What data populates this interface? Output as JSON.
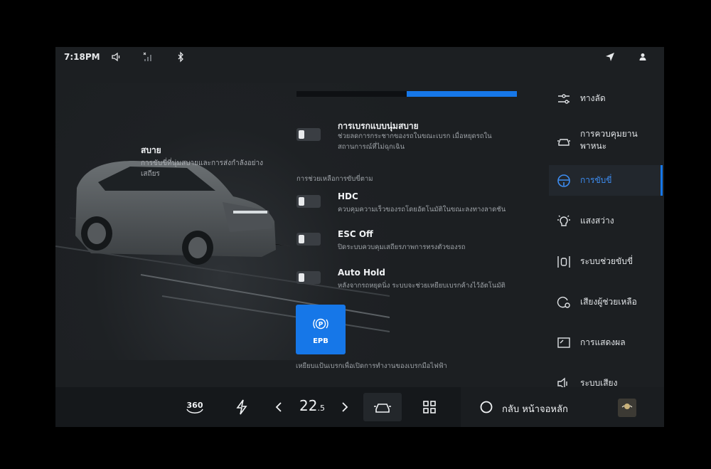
{
  "status": {
    "time": "7:18PM",
    "icons": [
      "volume-icon",
      "signal-icon",
      "bluetooth-icon",
      "navigation-icon",
      "user-icon"
    ]
  },
  "hero": {
    "title": "สบาย",
    "description": "การขับขี่ที่นุ่มสบายและการส่งกำลังอย่างเสถียร"
  },
  "progress": {
    "fraction": 0.5
  },
  "settings": [
    {
      "title": "การเบรกแบบนุ่มสบาย",
      "desc_line1": "ช่วยลดการกระชากของรถในขณะเบรก เมื่อหยุดรถใน",
      "desc_line2": "สถานการณ์ที่ไม่ฉุกเฉิน",
      "on": false
    },
    {
      "title": "HDC",
      "desc_line1": "ควบคุมความเร็วของรถโดยอัตโนมัติในขณะลงทางลาดชัน",
      "on": false
    },
    {
      "title": "ESC Off",
      "desc_line1": "ปิดระบบควบคุมเสถียรภาพการทรงตัวของรถ",
      "on": false
    },
    {
      "title": "Auto Hold",
      "desc_line1": "หลังจากรถหยุดนิ่ง ระบบจะช่วยเหยียบเบรกค้างไว้อัตโนมัติ",
      "on": false
    }
  ],
  "section_label": "การช่วยเหลือการขับขี่ตาม",
  "epb": {
    "label": "EPB",
    "note": "เหยียบแป้นเบรกเพื่อเปิดการทำงานของเบรกมือไฟฟ้า"
  },
  "sidebar": {
    "items": [
      {
        "label": "ทางลัด",
        "icon": "sliders-icon"
      },
      {
        "label": "การควบคุมยาน",
        "label2": "พาหนะ",
        "icon": "car-icon"
      },
      {
        "label": "การขับขี่",
        "icon": "steering-wheel-icon",
        "active": true
      },
      {
        "label": "แสงสว่าง",
        "icon": "light-bulb-icon"
      },
      {
        "label": "ระบบช่วยขับขี่",
        "icon": "driver-assist-icon"
      },
      {
        "label": "เสียงผู้ช่วยเหลือ",
        "icon": "voice-assistant-icon"
      },
      {
        "label": "การแสดงผล",
        "icon": "display-icon"
      },
      {
        "label": "ระบบเสียง",
        "icon": "speaker-icon"
      }
    ]
  },
  "dock": {
    "btn_360": "360",
    "temp_main": "22",
    "temp_dec": ".5",
    "home_label": "กลับ หน้าจอหลัก"
  },
  "colors": {
    "accent": "#1677e8",
    "background": "#1c1f22"
  }
}
